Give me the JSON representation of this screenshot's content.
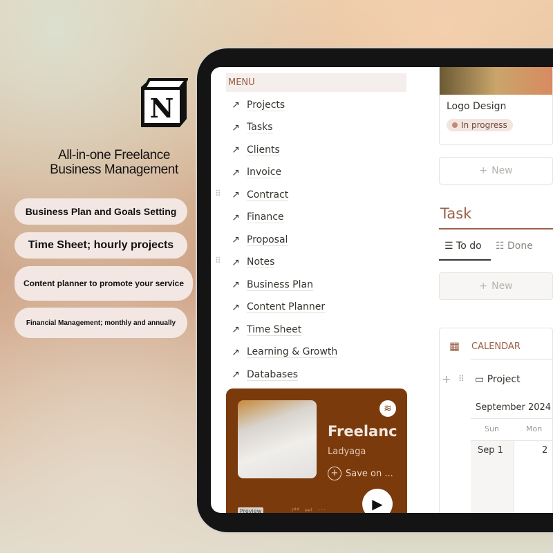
{
  "promo": {
    "headline_line1": "All-in-one Freelance",
    "headline_line2": "Business Management",
    "features": [
      "Business Plan and Goals Setting",
      "Time Sheet; hourly projects",
      "Content planner to promote your service",
      "Financial Management; monthly and annually"
    ],
    "logo_letter": "N"
  },
  "sidebar": {
    "title": "MENU",
    "items": [
      {
        "label": "Projects",
        "icon": "laptop-icon"
      },
      {
        "label": "Tasks",
        "icon": "clipboard-icon"
      },
      {
        "label": "Clients",
        "icon": "user-circle-icon"
      },
      {
        "label": "Invoice",
        "icon": "invoice-icon"
      },
      {
        "label": "Contract",
        "icon": "contract-icon"
      },
      {
        "label": "Finance",
        "icon": "finance-icon"
      },
      {
        "label": "Proposal",
        "icon": "proposal-icon"
      },
      {
        "label": "Notes",
        "icon": "notes-icon"
      },
      {
        "label": "Business Plan",
        "icon": "briefcase-icon"
      },
      {
        "label": "Content Planner",
        "icon": "planner-icon"
      },
      {
        "label": "Time Sheet",
        "icon": "timesheet-icon"
      },
      {
        "label": "Learning & Growth",
        "icon": "growth-icon"
      },
      {
        "label": "Databases",
        "icon": "gear-icon"
      }
    ]
  },
  "spotify": {
    "title": "Freelance",
    "artist": "Ladyaga",
    "save": "Save on ...",
    "preview": "Preview",
    "bg": "#7b3a0b"
  },
  "project_card": {
    "title": "Logo Design",
    "status": "In progress"
  },
  "new_label": "New",
  "task": {
    "title": "Task",
    "tabs": [
      "To do",
      "Done"
    ]
  },
  "calendar": {
    "title": "CALENDAR",
    "view": "Project",
    "month": "September 2024",
    "weekdays": [
      "Sun",
      "Mon"
    ],
    "days": [
      "Sep 1",
      "2"
    ]
  },
  "colors": {
    "accent": "#9b5f47"
  }
}
